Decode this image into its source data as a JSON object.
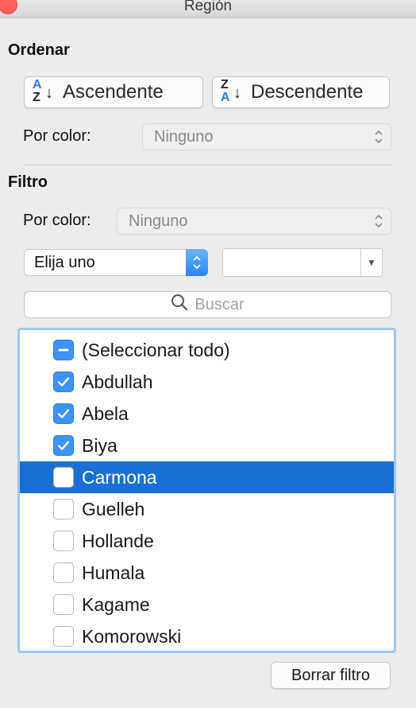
{
  "window": {
    "title": "Región"
  },
  "sort": {
    "heading": "Ordenar",
    "ascending_label": "Ascendente",
    "descending_label": "Descendente",
    "by_color_label": "Por color:",
    "by_color_value": "Ninguno"
  },
  "filter": {
    "heading": "Filtro",
    "by_color_label": "Por color:",
    "by_color_value": "Ninguno",
    "condition_value": "Elija uno",
    "value_field": "",
    "search_placeholder": "Buscar",
    "items": [
      {
        "label": "(Seleccionar todo)",
        "state": "mixed",
        "selected": false
      },
      {
        "label": "Abdullah",
        "state": "checked",
        "selected": false
      },
      {
        "label": "Abela",
        "state": "checked",
        "selected": false
      },
      {
        "label": "Biya",
        "state": "checked",
        "selected": false
      },
      {
        "label": "Carmona",
        "state": "unchecked",
        "selected": true
      },
      {
        "label": "Guelleh",
        "state": "unchecked",
        "selected": false
      },
      {
        "label": "Hollande",
        "state": "unchecked",
        "selected": false
      },
      {
        "label": "Humala",
        "state": "unchecked",
        "selected": false
      },
      {
        "label": "Kagame",
        "state": "unchecked",
        "selected": false
      },
      {
        "label": "Komorowski",
        "state": "unchecked",
        "selected": false
      }
    ],
    "clear_label": "Borrar filtro"
  },
  "colors": {
    "accent": "#1a6fd6",
    "checkbox": "#3e93f4",
    "list_border": "#9cc6f5",
    "close": "#fc605b"
  }
}
